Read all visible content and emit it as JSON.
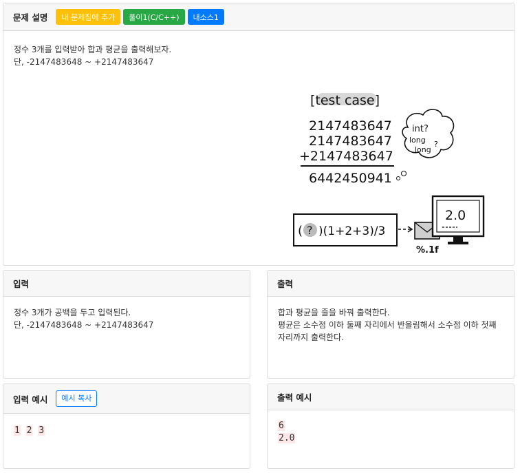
{
  "problem": {
    "title": "문제 설명",
    "buttons": {
      "add": "내 문제집에 추가",
      "solution": "풀이1(C/C++)",
      "source": "내소스1"
    },
    "description": [
      "정수 3개를 입력받아 합과 평균을 출력해보자.",
      "단, -2147483648 ~ +2147483647"
    ],
    "illustration": {
      "heading": "[test case]",
      "addends": [
        "2147483647",
        "2147483647",
        "+2147483647"
      ],
      "sum": "6442450941",
      "bubble": [
        "int?",
        "long",
        "long",
        "?"
      ],
      "formula_q": "?",
      "formula": ")(1+2+3)/3",
      "screen_value": "2.0",
      "format": "%.1f"
    }
  },
  "input": {
    "title": "입력",
    "lines": [
      "정수 3개가 공백을 두고 입력된다.",
      "단, -2147483648 ~ +2147483647"
    ]
  },
  "output": {
    "title": "출력",
    "lines": [
      "합과 평균을 줄을 바꿔 출력한다.",
      "평균은 소수점 이하 둘째 자리에서 반올림해서 소수점 이하 첫째 자리까지 출력한다."
    ]
  },
  "sample_input": {
    "title": "입력 예시",
    "copy_label": "예시 복사",
    "values": [
      "1",
      "2",
      "3"
    ]
  },
  "sample_output": {
    "title": "출력 예시",
    "lines": [
      "6",
      "2.0"
    ]
  },
  "colors": {
    "warning": "#ffc107",
    "success": "#28a745",
    "primary": "#007bff"
  }
}
